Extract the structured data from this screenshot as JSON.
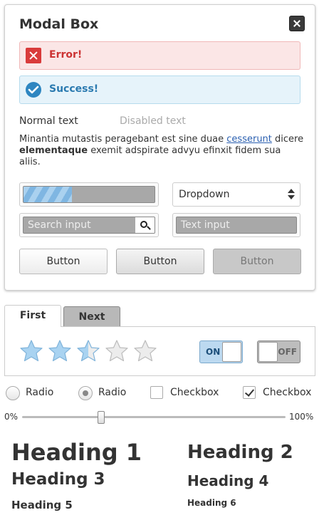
{
  "modal": {
    "title": "Modal Box",
    "error_text": "Error!",
    "success_text": "Success!",
    "normal_text": "Normal text",
    "disabled_text": "Disabled text",
    "paragraph": {
      "part1": "Minantia  mutastis peragebant est sine duae ",
      "link": "cesserunt",
      "part2": " dicere ",
      "bold": "elementaque",
      "part3": " exemit adspirate advyu efinxit fidem sua aliis."
    },
    "progress_fraction": 0.37,
    "dropdown_label": "Dropdown",
    "search_placeholder": "Search input",
    "text_placeholder": "Text input",
    "buttons": [
      "Button",
      "Button",
      "Button"
    ]
  },
  "tabs": {
    "first": "First",
    "next": "Next",
    "rating": {
      "value": 2.5,
      "max": 5
    },
    "toggle_on": "ON",
    "toggle_off": "OFF"
  },
  "controls": {
    "radio1": "Radio",
    "radio2": "Radio",
    "checkbox1": "Checkbox",
    "checkbox2": "Checkbox"
  },
  "slider": {
    "min_label": "0%",
    "max_label": "100%",
    "value": 0.3
  },
  "headings": {
    "h1": "Heading 1",
    "h2": "Heading 2",
    "h3": "Heading 3",
    "h4": "Heading 4",
    "h5": "Heading 5",
    "h6": "Heading 6"
  },
  "icons": {
    "close": "close-icon",
    "error": "error-icon",
    "success": "checkmark-icon",
    "search": "search-icon",
    "star": "star-icon"
  },
  "colors": {
    "error": "#d93b3b",
    "success": "#2e86c1",
    "star_fill": "#a9d3f1",
    "toggle_on": "#bcd9f0"
  }
}
